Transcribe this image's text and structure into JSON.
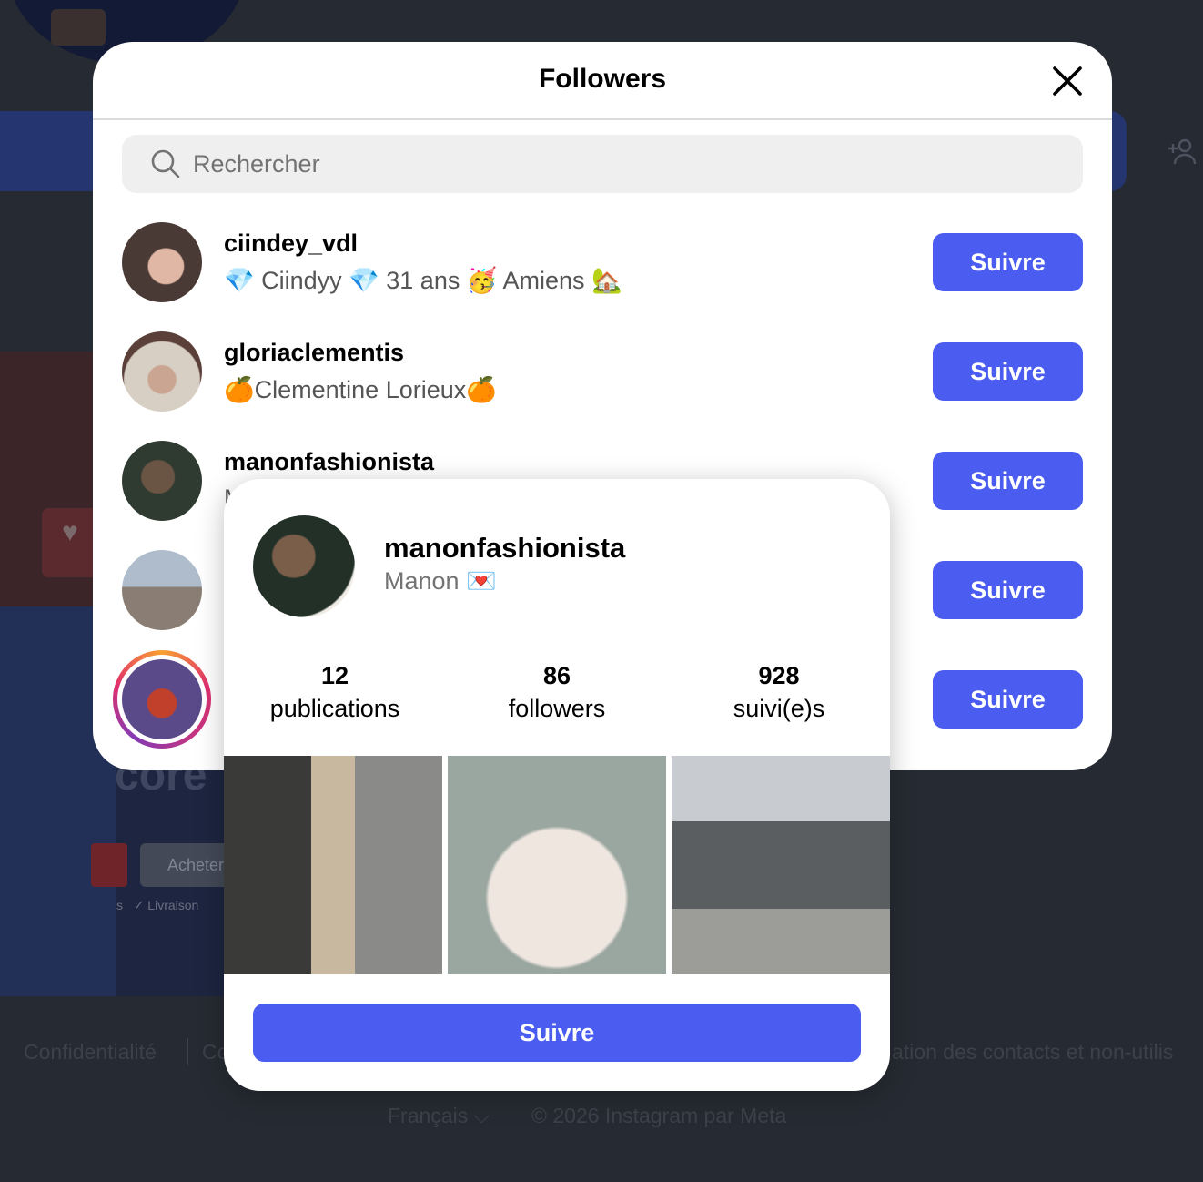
{
  "background": {
    "post": {
      "overlay_text": "core",
      "buy_button_label": "Acheter",
      "shipping_text": "Livraison"
    },
    "footer": {
      "links": [
        "Confidentialité",
        "Co",
        "ation des contacts et non-utilis"
      ],
      "language": "Français",
      "copyright": "© 2026 Instagram par Meta"
    },
    "icons": {
      "add_user": "person-add-icon",
      "heart": "heart-icon",
      "chevron": "chevron-down-icon"
    }
  },
  "modal": {
    "title": "Followers",
    "close_icon": "close-icon",
    "search": {
      "placeholder": "Rechercher",
      "value": "",
      "icon": "search-icon"
    },
    "followers": [
      {
        "username": "ciindey_vdl",
        "bio": "💎 Ciindyy 💎 31 ans 🥳 Amiens 🏡",
        "button": "Suivre",
        "avatar_color": "#5a4a48"
      },
      {
        "username": "gloriaclementis",
        "bio": "🍊Clementine Lorieux🍊",
        "button": "Suivre",
        "avatar_color": "#7a6a5e"
      },
      {
        "username": "manonfashionista",
        "bio": "M",
        "button": "Suivre",
        "avatar_color": "#3d3a34"
      },
      {
        "username": "",
        "bio": "",
        "button": "Suivre",
        "avatar_color": "#8a8f95"
      },
      {
        "username": "",
        "bio": "",
        "button": "Suivre",
        "avatar_color": "#3a2e5a",
        "has_story": true
      }
    ]
  },
  "hover_card": {
    "username": "manonfashionista",
    "name": "Manon 💌",
    "stats": [
      {
        "value": "12",
        "label": "publications"
      },
      {
        "value": "86",
        "label": "followers"
      },
      {
        "value": "928",
        "label": "suivi(e)s"
      }
    ],
    "photos": [
      "street-photo",
      "fur-coat-photo",
      "sidewalk-photo"
    ],
    "follow_button": "Suivre"
  },
  "colors": {
    "accent": "#4a5df0",
    "modal_bg": "#ffffff",
    "backdrop": "#262a32",
    "muted_text": "#737373"
  }
}
